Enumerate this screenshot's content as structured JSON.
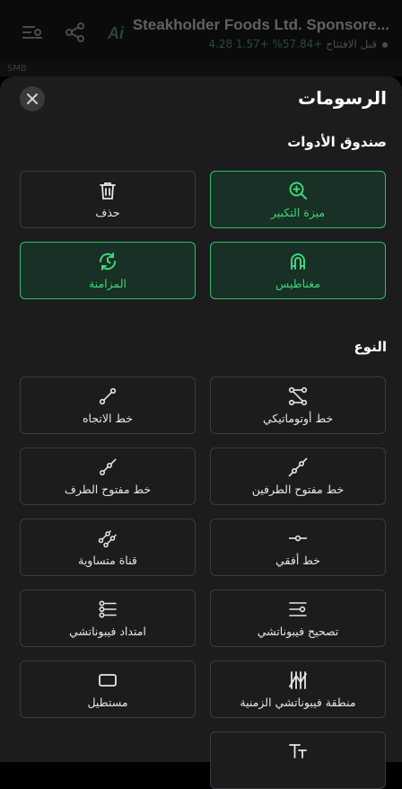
{
  "background_app": {
    "title": "Steakholder Foods Ltd. Sponsore...",
    "price_line": "قبل الافتتاح",
    "price_change": "+57.84% +1.57 4.28",
    "strip_text": "SMB",
    "icons": [
      "list-settings-icon",
      "share-icon",
      "ai-icon"
    ]
  },
  "sheet": {
    "title": "الرسومات",
    "close_icon": "close-icon"
  },
  "toolbox": {
    "heading": "صندوق الأدوات",
    "items": [
      {
        "label": "ميزة التكبير",
        "icon": "zoom-in-icon",
        "active": true
      },
      {
        "label": "حذف",
        "icon": "trash-icon",
        "active": false
      },
      {
        "label": "مغناطيس",
        "icon": "magnet-icon",
        "active": true
      },
      {
        "label": "المزامنة",
        "icon": "sync-icon",
        "active": true
      }
    ]
  },
  "types": {
    "heading": "النوع",
    "items": [
      {
        "label": "خط أوتوماتيكي",
        "icon": "auto-line-icon"
      },
      {
        "label": "خط الاتجاه",
        "icon": "trend-line-icon"
      },
      {
        "label": "خط مفتوح الطرفين",
        "icon": "extended-line-icon"
      },
      {
        "label": "خط مفتوح الطرف",
        "icon": "ray-line-icon"
      },
      {
        "label": "خط أفقي",
        "icon": "horizontal-line-icon"
      },
      {
        "label": "قناة متساوية",
        "icon": "parallel-channel-icon"
      },
      {
        "label": "تصحيح فيبوناتشي",
        "icon": "fib-retracement-icon"
      },
      {
        "label": "امتداد فيبوناتشي",
        "icon": "fib-extension-icon"
      },
      {
        "label": "منطقة فيبوناتشي الزمنية",
        "icon": "fib-timezone-icon"
      },
      {
        "label": "مستطيل",
        "icon": "rectangle-icon"
      },
      {
        "label": "",
        "icon": "text-icon"
      }
    ]
  },
  "colors": {
    "accent": "#2fbf68",
    "sheet_bg": "#1c1c1e",
    "tile_border": "#3b3b3f"
  }
}
